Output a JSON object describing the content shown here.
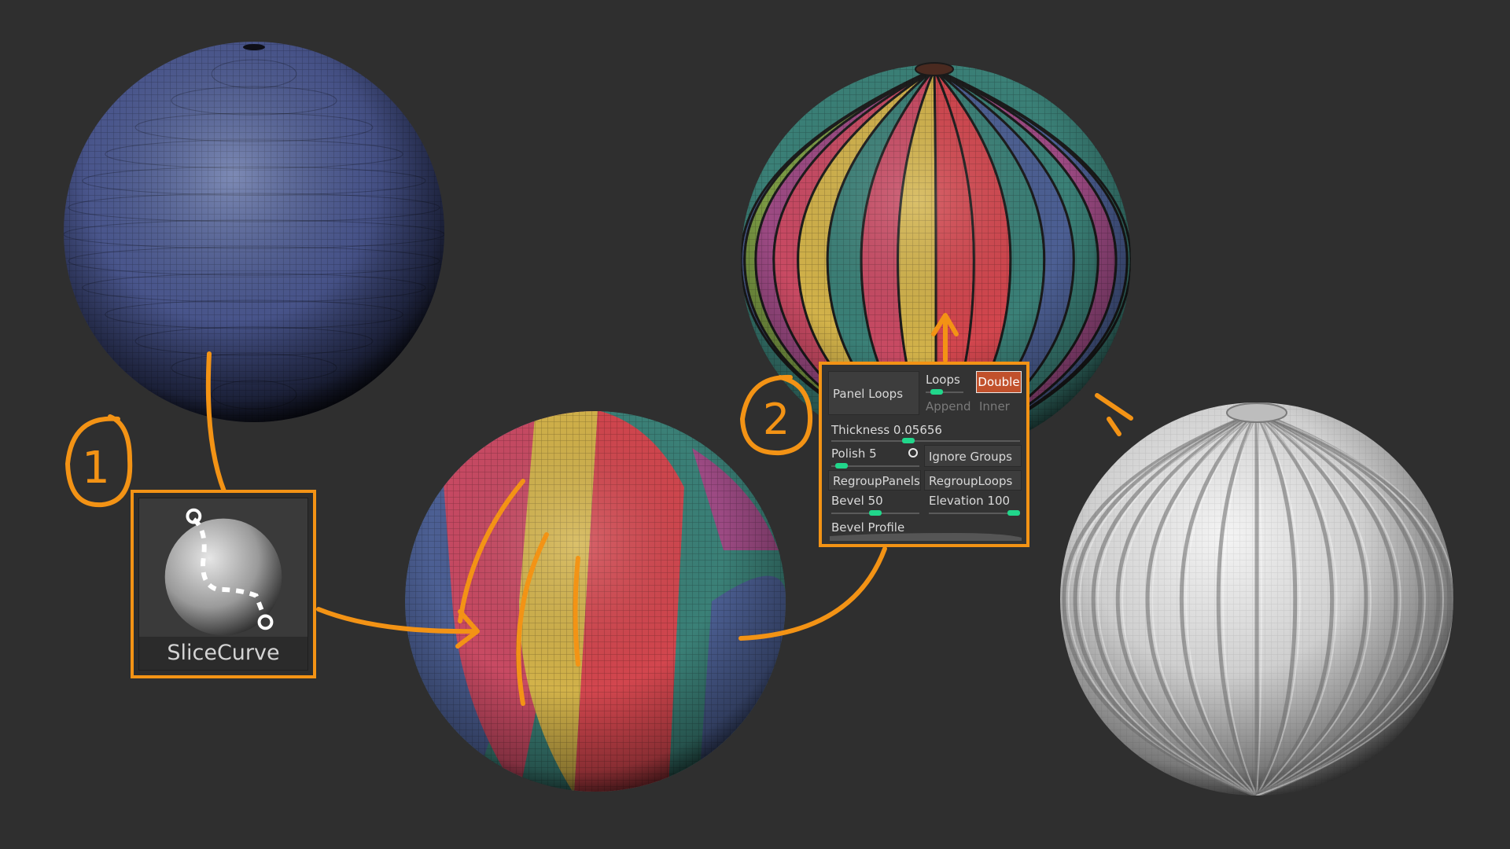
{
  "steps": {
    "one": "1",
    "two": "2"
  },
  "brush": {
    "label": "SliceCurve"
  },
  "panel": {
    "panel_loops": "Panel Loops",
    "loops": "Loops",
    "double": "Double",
    "append": "Append",
    "inner": "Inner",
    "thickness_label": "Thickness",
    "thickness_value": "0.05656",
    "polish_label": "Polish",
    "polish_value": "5",
    "ignore_groups": "Ignore Groups",
    "regroup_panels": "RegroupPanels",
    "regroup_loops": "RegroupLoops",
    "bevel_label": "Bevel",
    "bevel_value": "50",
    "elevation_label": "Elevation",
    "elevation_value": "100",
    "bevel_profile": "Bevel Profile",
    "loops_level": 0.2,
    "thickness_level": 0.4,
    "polish_level": 0.05,
    "bevel_level": 0.5,
    "elevation_level": 1.0
  },
  "colors": {
    "accent": "#f39315",
    "background": "#2f2f2f",
    "sphere_blue": "#4a5788",
    "slider": "#21d78b",
    "double_button": "#c1512c",
    "polygroups": [
      "#c84a63",
      "#d2b24a",
      "#d2464e",
      "#3b8077",
      "#4c5f93",
      "#7b9a44",
      "#9c4a83"
    ]
  }
}
